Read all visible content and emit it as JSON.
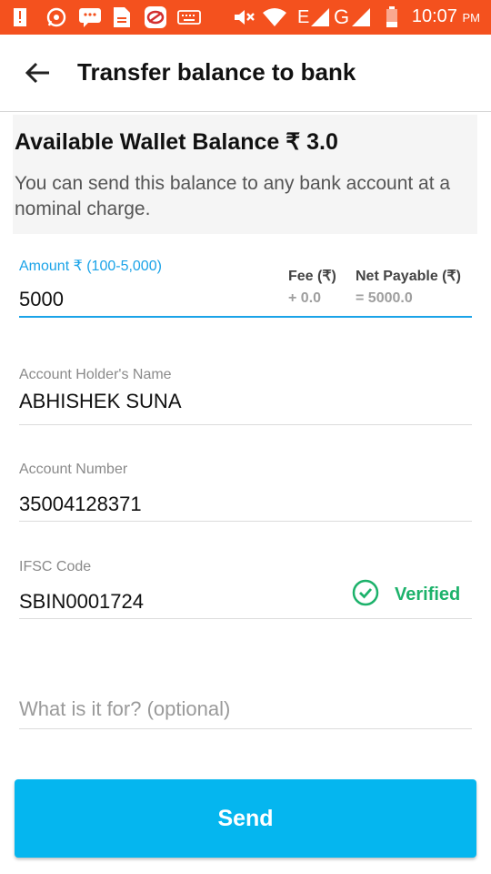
{
  "status_bar": {
    "time": "10:07",
    "ampm": "PM",
    "network_label": "E",
    "network_label_2": "G",
    "icons": [
      "alert-icon",
      "whatsapp-icon",
      "messenger-icon",
      "file-icon",
      "app-icon",
      "keyboard-icon",
      "mute-icon",
      "wifi-icon",
      "signal-icon",
      "signal-icon-2",
      "battery-icon"
    ],
    "bg_color": "#f4511e"
  },
  "app_bar": {
    "title": "Transfer balance to bank",
    "back_icon": "arrow-left-icon"
  },
  "balance_card": {
    "title": "Available Wallet Balance ₹ 3.0",
    "description": "You can send this balance to any bank account at a nominal charge."
  },
  "amount": {
    "label": "Amount ₹ (100-5,000)",
    "value": "5000",
    "fee_header": "Fee (₹)",
    "fee_value": "+ 0.0",
    "net_header": "Net Payable (₹)",
    "net_value": "= 5000.0",
    "accent_color": "#1aa3e8"
  },
  "account_holder": {
    "label": "Account Holder's Name",
    "value": "ABHISHEK SUNA"
  },
  "account_number": {
    "label": "Account Number",
    "value": "35004128371"
  },
  "ifsc": {
    "label": "IFSC Code",
    "value": "SBIN0001724",
    "verified_label": "Verified",
    "verified_color": "#1db26b"
  },
  "purpose": {
    "placeholder": "What is it for? (optional)"
  },
  "send_button": {
    "label": "Send",
    "color": "#05b6ef"
  }
}
